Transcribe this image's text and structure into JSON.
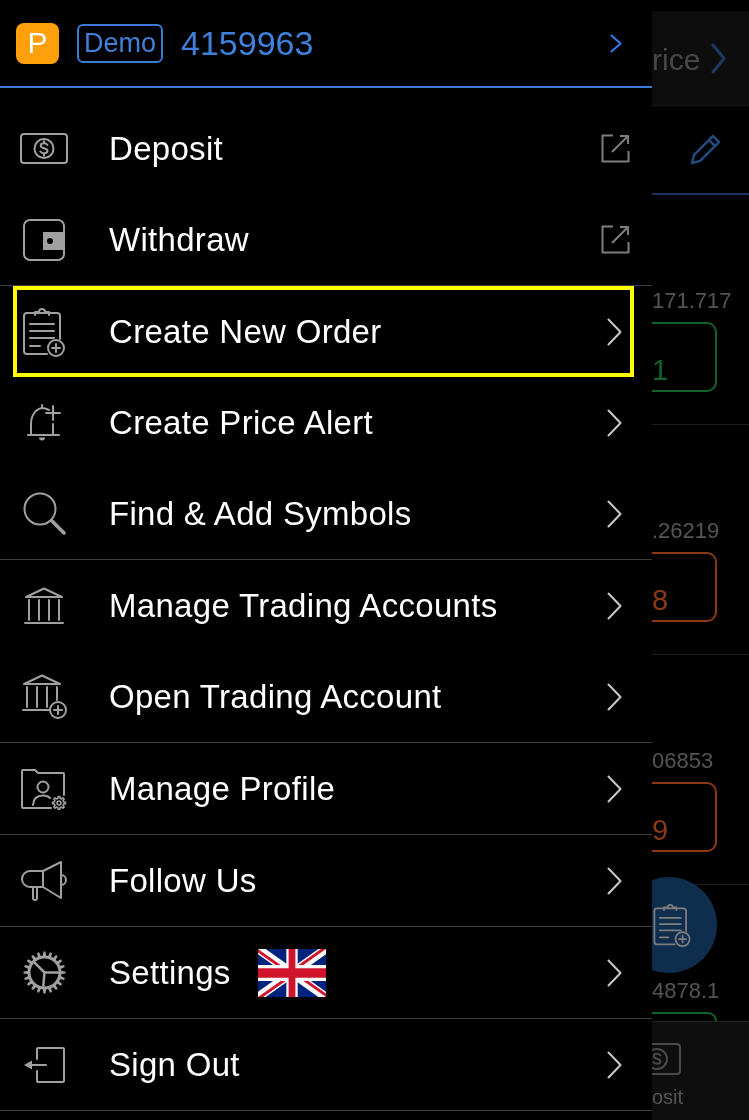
{
  "header": {
    "badge": "P",
    "account_type": "Demo",
    "account_number": "4159963"
  },
  "sections": [
    {
      "items": [
        {
          "label": "Deposit",
          "kind": "external",
          "highlighted": false,
          "flag": false
        },
        {
          "label": "Withdraw",
          "kind": "external",
          "highlighted": false,
          "flag": false
        }
      ]
    },
    {
      "items": [
        {
          "label": "Create New Order",
          "kind": "chevron",
          "highlighted": true,
          "flag": false
        },
        {
          "label": "Create Price Alert",
          "kind": "chevron",
          "highlighted": false,
          "flag": false
        },
        {
          "label": "Find & Add Symbols",
          "kind": "chevron",
          "highlighted": false,
          "flag": false
        }
      ]
    },
    {
      "items": [
        {
          "label": "Manage Trading Accounts",
          "kind": "chevron",
          "highlighted": false,
          "flag": false
        },
        {
          "label": "Open Trading Account",
          "kind": "chevron",
          "highlighted": false,
          "flag": false
        }
      ]
    },
    {
      "items": [
        {
          "label": "Manage Profile",
          "kind": "chevron",
          "highlighted": false,
          "flag": false
        }
      ]
    },
    {
      "items": [
        {
          "label": "Follow Us",
          "kind": "chevron",
          "highlighted": false,
          "flag": false
        }
      ]
    },
    {
      "items": [
        {
          "label": "Settings",
          "kind": "chevron",
          "highlighted": false,
          "flag": true
        }
      ]
    },
    {
      "items": [
        {
          "label": "Sign Out",
          "kind": "chevron",
          "highlighted": false,
          "flag": false
        }
      ]
    }
  ],
  "background_screen": {
    "title": "rice",
    "quotes": [
      {
        "value": "171.717",
        "price": "1",
        "color": "#11632a"
      },
      {
        "value": ".26219",
        "price": "8",
        "color": "#8c3a16"
      },
      {
        "value": "06853",
        "price": "9",
        "color": "#8c3a16"
      },
      {
        "value": "4878.1",
        "color": "#11632a"
      }
    ],
    "tab_label": "osit"
  }
}
